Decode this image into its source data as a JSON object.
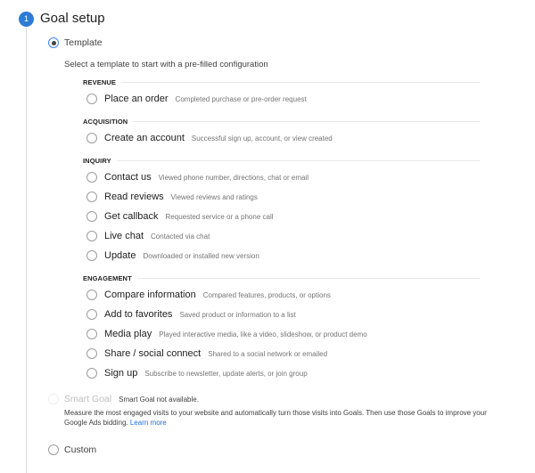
{
  "step": {
    "number": "1",
    "title": "Goal setup"
  },
  "template_option": {
    "label": "Template",
    "selected": true,
    "intro": "Select a template to start with a pre-filled configuration"
  },
  "sections": [
    {
      "heading": "REVENUE",
      "items": [
        {
          "label": "Place an order",
          "description": "Completed purchase or pre-order request"
        }
      ]
    },
    {
      "heading": "ACQUISITION",
      "items": [
        {
          "label": "Create an account",
          "description": "Successful sign up, account, or view created"
        }
      ]
    },
    {
      "heading": "INQUIRY",
      "items": [
        {
          "label": "Contact us",
          "description": "Viewed phone number, directions, chat or email"
        },
        {
          "label": "Read reviews",
          "description": "Viewed reviews and ratings"
        },
        {
          "label": "Get callback",
          "description": "Requested service or a phone call"
        },
        {
          "label": "Live chat",
          "description": "Contacted via chat"
        },
        {
          "label": "Update",
          "description": "Downloaded or installed new version"
        }
      ]
    },
    {
      "heading": "ENGAGEMENT",
      "items": [
        {
          "label": "Compare information",
          "description": "Compared features, products, or options"
        },
        {
          "label": "Add to favorites",
          "description": "Saved product or information to a list"
        },
        {
          "label": "Media play",
          "description": "Played interactive media, like a video, slideshow, or product demo"
        },
        {
          "label": "Share / social connect",
          "description": "Shared to a social network or emailed"
        },
        {
          "label": "Sign up",
          "description": "Subscribe to newsletter, update alerts, or join group"
        }
      ]
    }
  ],
  "smart_goal": {
    "label": "Smart Goal",
    "note": "Smart Goal not available.",
    "description": "Measure the most engaged visits to your website and automatically turn those visits into Goals. Then use those Goals to improve your Google Ads bidding.",
    "link": "Learn more",
    "disabled": true
  },
  "custom_option": {
    "label": "Custom",
    "selected": false
  },
  "colors": {
    "accent": "#2f7bd6",
    "link": "#1a73e8"
  }
}
